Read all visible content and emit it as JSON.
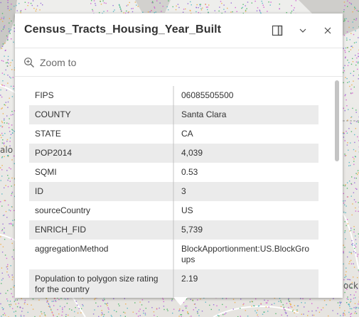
{
  "map": {
    "label_left": "alo",
    "label_right": "ock"
  },
  "popup": {
    "title": "Census_Tracts_Housing_Year_Built",
    "actions": {
      "zoom_label": "Zoom to",
      "zoom_icon": "zoom-in-icon"
    },
    "buttons": {
      "dock_icon": "dock-icon",
      "collapse_icon": "chevron-down-icon",
      "close_icon": "close-icon"
    },
    "fields": [
      {
        "key": "FIPS",
        "value": "06085505500"
      },
      {
        "key": "COUNTY",
        "value": "Santa Clara"
      },
      {
        "key": "STATE",
        "value": "CA"
      },
      {
        "key": "POP2014",
        "value": "4,039"
      },
      {
        "key": "SQMI",
        "value": "0.53"
      },
      {
        "key": "ID",
        "value": "3"
      },
      {
        "key": "sourceCountry",
        "value": "US"
      },
      {
        "key": "ENRICH_FID",
        "value": "5,739"
      },
      {
        "key": "aggregationMethod",
        "value": "BlockApportionment:US.BlockGroups"
      },
      {
        "key": "Population to polygon size rating for the country",
        "value": "2.19"
      }
    ]
  },
  "colors": {
    "accent": "#323232",
    "alt_row": "#ebebeb",
    "map_dots": [
      "#d14fd1",
      "#44b3c2",
      "#f0a63a",
      "#8c5bd6",
      "#3cb35a"
    ]
  }
}
